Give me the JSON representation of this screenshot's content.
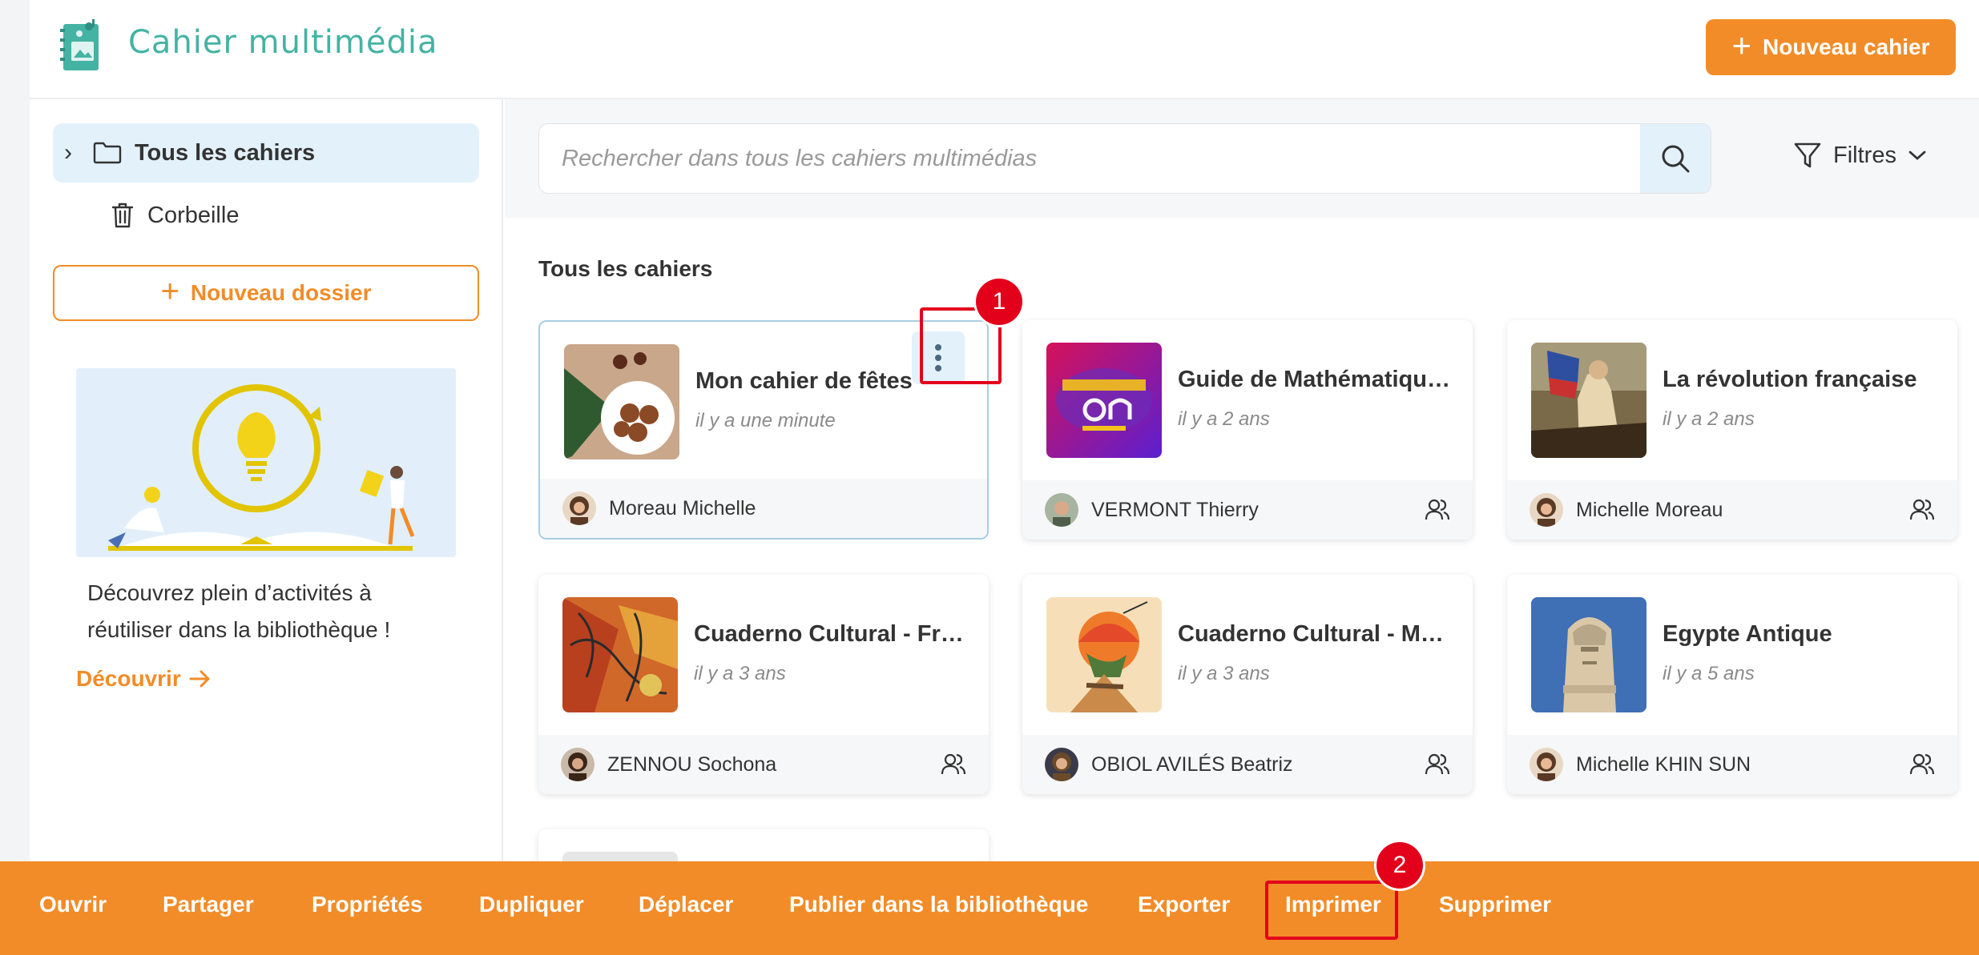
{
  "header": {
    "app_title": "Cahier multimédia",
    "new_notebook_label": "Nouveau cahier"
  },
  "sidebar": {
    "items": [
      {
        "label": "Tous les cahiers",
        "icon": "folder-icon",
        "selected": true
      },
      {
        "label": "Corbeille",
        "icon": "trash-icon",
        "selected": false
      }
    ],
    "new_folder_label": "Nouveau dossier",
    "promo": {
      "text": "Découvrez plein d’activités à réutiliser dans la bibliothèque !",
      "link_label": "Découvrir"
    }
  },
  "main": {
    "search_placeholder": "Rechercher dans tous les cahiers multimédias",
    "filters_label": "Filtres",
    "section_title": "Tous les cahiers",
    "cards": [
      {
        "title": "Mon cahier de fêtes",
        "date": "il y a une minute",
        "owner": "Moreau Michelle",
        "shared": false,
        "selected": true
      },
      {
        "title": "Guide de Mathématiques Pour les élèves",
        "date": "il y a 2 ans",
        "owner": "VERMONT Thierry",
        "shared": true,
        "selected": false
      },
      {
        "title": "La révolution française",
        "date": "il y a 2 ans",
        "owner": "Michelle Moreau",
        "shared": true,
        "selected": false
      },
      {
        "title": "Cuaderno Cultural - Francia",
        "date": "il y a 3 ans",
        "owner": "ZENNOU Sochona",
        "shared": true,
        "selected": false
      },
      {
        "title": "Cuaderno Cultural - Mexico",
        "date": "il y a 3 ans",
        "owner": "OBIOL AVILÉS Beatriz",
        "shared": true,
        "selected": false
      },
      {
        "title": "Egypte Antique",
        "date": "il y a 5 ans",
        "owner": "Michelle KHIN SUN",
        "shared": true,
        "selected": false
      }
    ]
  },
  "actionbar": {
    "actions": [
      "Ouvrir",
      "Partager",
      "Propriétés",
      "Dupliquer",
      "Déplacer",
      "Publier dans la bibliothèque",
      "Exporter",
      "Imprimer",
      "Supprimer"
    ]
  },
  "annotations": {
    "badge_1": "1",
    "badge_2": "2"
  },
  "colors": {
    "accent": "#f28c28",
    "brand": "#44b3a3",
    "selection": "#e3f1fb",
    "annotation": "#e3001b"
  }
}
